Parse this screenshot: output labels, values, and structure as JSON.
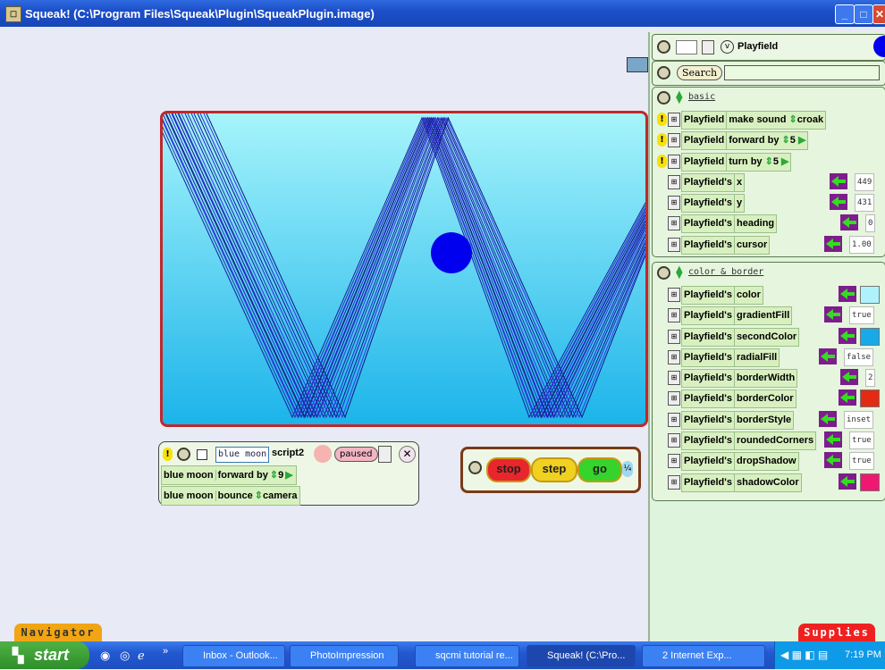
{
  "window": {
    "title": "Squeak! (C:\\Program Files\\Squeak\\Plugin\\SqueakPlugin.image)"
  },
  "flap": {
    "header_title": "Playfield",
    "header_v": "v",
    "search_label": "Search",
    "search_value": "",
    "basic_section": {
      "label": "basic",
      "rows": [
        {
          "bang": true,
          "subject": "Playfield",
          "command": "make sound",
          "arg": "croak"
        },
        {
          "bang": true,
          "subject": "Playfield",
          "command": "forward by",
          "arg": "5"
        },
        {
          "bang": true,
          "subject": "Playfield",
          "command": "turn by",
          "arg": "5"
        },
        {
          "bang": false,
          "subject": "Playfield's",
          "command": "x",
          "value": "449"
        },
        {
          "bang": false,
          "subject": "Playfield's",
          "command": "y",
          "value": "431"
        },
        {
          "bang": false,
          "subject": "Playfield's",
          "command": "heading",
          "value": "0"
        },
        {
          "bang": false,
          "subject": "Playfield's",
          "command": "cursor",
          "value": "1.00"
        }
      ]
    },
    "color_section": {
      "label": "color & border",
      "rows": [
        {
          "subject": "Playfield's",
          "command": "color",
          "swatch": "#aef3fb"
        },
        {
          "subject": "Playfield's",
          "command": "gradientFill",
          "value": "true"
        },
        {
          "subject": "Playfield's",
          "command": "secondColor",
          "swatch": "#17a9e8"
        },
        {
          "subject": "Playfield's",
          "command": "radialFill",
          "value": "false"
        },
        {
          "subject": "Playfield's",
          "command": "borderWidth",
          "value": "2"
        },
        {
          "subject": "Playfield's",
          "command": "borderColor",
          "swatch": "#e32a12"
        },
        {
          "subject": "Playfield's",
          "command": "borderStyle",
          "value": "inset"
        },
        {
          "subject": "Playfield's",
          "command": "roundedCorners",
          "value": "true"
        },
        {
          "subject": "Playfield's",
          "command": "dropShadow",
          "value": "true"
        },
        {
          "subject": "Playfield's",
          "command": "shadowColor",
          "swatch": "#ef1870"
        }
      ]
    }
  },
  "script": {
    "owner": "blue moon",
    "name": "script2",
    "status": "paused",
    "lines": [
      {
        "subject": "blue moon",
        "command": "forward by",
        "arg": "9"
      },
      {
        "subject": "blue moon",
        "command": "bounce",
        "arg": "camera"
      }
    ]
  },
  "controls": {
    "stop": "stop",
    "step": "step",
    "go": "go",
    "speed": "¼"
  },
  "tabs": {
    "navigator": "Navigator",
    "supplies": "Supplies"
  },
  "taskbar": {
    "start": "start",
    "items": [
      "Inbox - Outlook...",
      "PhotoImpression",
      "sqcmi tutorial re...",
      "Squeak! (C:\\Pro...",
      "2 Internet Exp..."
    ],
    "clock": "7:19 PM"
  },
  "colors": {
    "titlebar": "#2358d0",
    "playfield_border": "#c0282a",
    "ball": "#0000ee",
    "stop": "#e8262b",
    "step": "#f0d020",
    "go": "#36d32c"
  }
}
